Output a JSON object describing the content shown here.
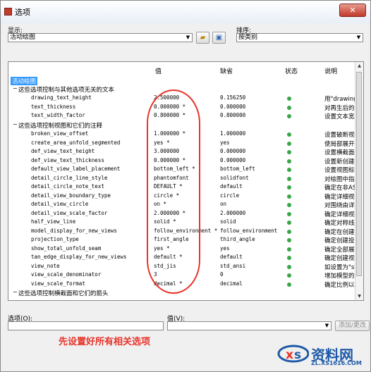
{
  "window": {
    "title": "选项",
    "close_label": "✕"
  },
  "display": {
    "label": "显示:",
    "value": "活动绘图"
  },
  "sort": {
    "label": "排序:",
    "value": "按类别"
  },
  "columns": {
    "value": "值",
    "default": "缺省",
    "status": "状态",
    "description": "说明"
  },
  "tree": {
    "root": "活动绘图",
    "group1": "这些选项控制与其他选项无关的文本",
    "group2": "这些选项控制视图和它们的注释",
    "group3": "这些选项控制横截面和它们的箭头"
  },
  "rows": [
    {
      "name": "drawing_text_height",
      "value": "2.500000",
      "default": "0.156250",
      "desc": "用\"drawing_t"
    },
    {
      "name": "text_thickness",
      "value": "0.000000 *",
      "default": "0.000000",
      "desc": "对再生后的新"
    },
    {
      "name": "text_width_factor",
      "value": "0.800000 *",
      "default": "0.800000",
      "desc": "设置文本宽度"
    },
    {
      "name": "broken_view_offset",
      "value": "1.000000 *",
      "default": "1.000000",
      "desc": "设置破断视图"
    },
    {
      "name": "create_area_unfold_segmented",
      "value": "yes *",
      "default": "yes",
      "desc": "使局部展开图"
    },
    {
      "name": "def_view_text_height",
      "value": "3.000000",
      "default": "0.000000",
      "desc": "设置横截面视"
    },
    {
      "name": "def_view_text_thickness",
      "value": "0.000000 *",
      "default": "0.000000",
      "desc": "设置新创建的"
    },
    {
      "name": "default_view_label_placement",
      "value": "bottom_left *",
      "default": "bottom_left",
      "desc": "设置视图标签"
    },
    {
      "name": "detail_circle_line_style",
      "value": "phantomfont",
      "default": "solidfont",
      "desc": "对绘图中指示"
    },
    {
      "name": "detail_circle_note_text",
      "value": "DEFAULT *",
      "default": "default",
      "desc": "确定在非ASME"
    },
    {
      "name": "detail_view_boundary_type",
      "value": "circle *",
      "default": "circle",
      "desc": "确定详细视图"
    },
    {
      "name": "detail_view_circle",
      "value": "on *",
      "default": "on",
      "desc": "对围绕由详细"
    },
    {
      "name": "detail_view_scale_factor",
      "value": "2.000000 *",
      "default": "2.000000",
      "desc": "确定详细视图"
    },
    {
      "name": "half_view_line",
      "value": "solid *",
      "default": "solid",
      "desc": "确定对称线的"
    },
    {
      "name": "model_display_for_new_views",
      "value": "follow_environment *",
      "default": "follow_environment",
      "desc": "确定在创建视"
    },
    {
      "name": "projection_type",
      "value": "first_angle",
      "default": "third_angle",
      "desc": "确定创建投影"
    },
    {
      "name": "show_total_unfold_seam",
      "value": "yes *",
      "default": "yes",
      "desc": "确定全部展开"
    },
    {
      "name": "tan_edge_display_for_new_views",
      "value": "default *",
      "default": "default",
      "desc": "确定创建视图"
    },
    {
      "name": "view_note",
      "value": "std_jis",
      "default": "std_ansi",
      "desc": "如设置为\"std"
    },
    {
      "name": "view_scale_denominator",
      "value": "3",
      "default": "0",
      "desc": "增加模型的舞"
    },
    {
      "name": "view_scale_format",
      "value": "decimal *",
      "default": "decimal",
      "desc": "确定比例以十"
    }
  ],
  "option_field": {
    "label": "选项(O):",
    "value": ""
  },
  "value_field": {
    "label": "值(V):",
    "value": ""
  },
  "add_change_button": "添加/更改",
  "annotation": "先设置好所有相关选项",
  "watermark": {
    "text": "资料网",
    "url": "ZL.XS1616.COM"
  },
  "colors": {
    "status_dot": "#3aa64b",
    "annotation": "#e8332a",
    "highlight": "#3399ff"
  }
}
